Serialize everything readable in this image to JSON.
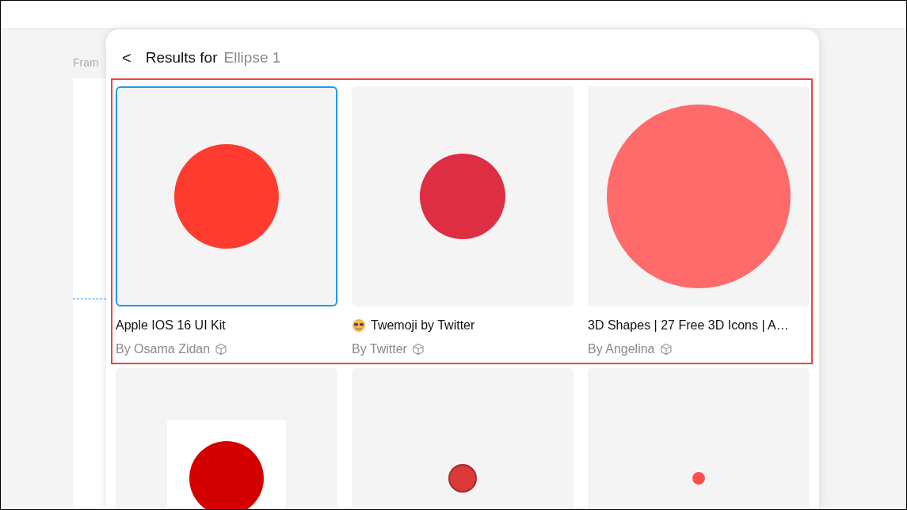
{
  "canvas": {
    "frame_label": "Fram"
  },
  "panel": {
    "back": "<",
    "title": "Results for",
    "query": "Ellipse 1"
  },
  "results": [
    {
      "title": "Apple IOS 16 UI Kit",
      "author": "By Osama Zidan",
      "selected": true,
      "emoji": false
    },
    {
      "title": "Twemoji by Twitter",
      "author": "By Twitter",
      "selected": false,
      "emoji": true
    },
    {
      "title": "3D Shapes | 27 Free 3D Icons | A…",
      "author": "By Angelina",
      "selected": false,
      "emoji": false
    },
    {
      "selected": false
    },
    {
      "selected": false
    },
    {
      "selected": false
    }
  ]
}
